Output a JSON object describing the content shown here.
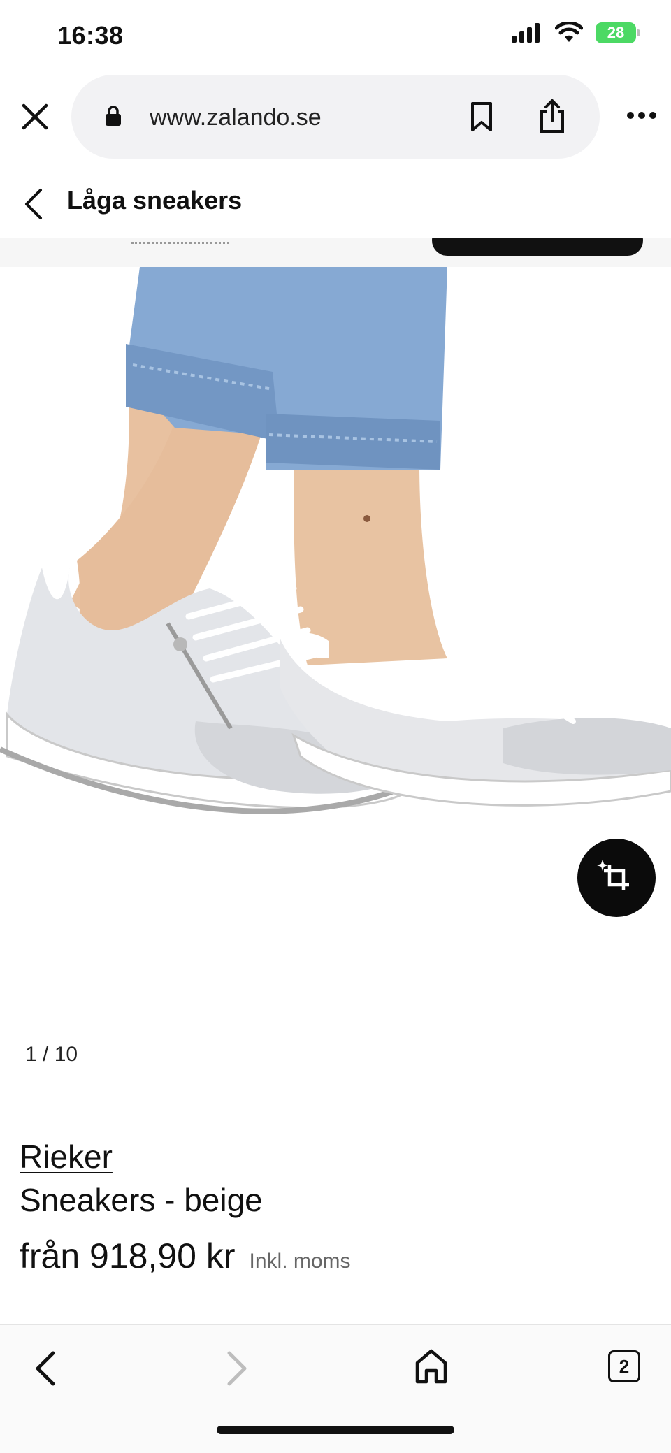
{
  "status_bar": {
    "time": "16:38",
    "battery": "28",
    "icons": [
      "signal-icon",
      "wifi-icon",
      "battery-charging-icon"
    ]
  },
  "browser": {
    "url": "www.zalando.se",
    "icons": [
      "close-icon",
      "lock-icon",
      "bookmark-icon",
      "share-icon",
      "more-icon"
    ]
  },
  "page": {
    "title": "Låga sneakers",
    "image_counter": "1 / 10",
    "tryon_icon": "crop-sparkle-icon"
  },
  "product": {
    "brand": "Rieker",
    "name": "Sneakers - beige",
    "price": "från 918,90 kr",
    "tax_note": "Inkl. moms"
  },
  "toolbar": {
    "tab_count": "2",
    "icons": [
      "back-icon",
      "forward-icon",
      "home-icon",
      "tabs-icon"
    ]
  },
  "colors": {
    "accent": "#111111",
    "battery": "#4cd964",
    "denim": "#7fa3cf",
    "shoe": "#e2e4e8"
  }
}
